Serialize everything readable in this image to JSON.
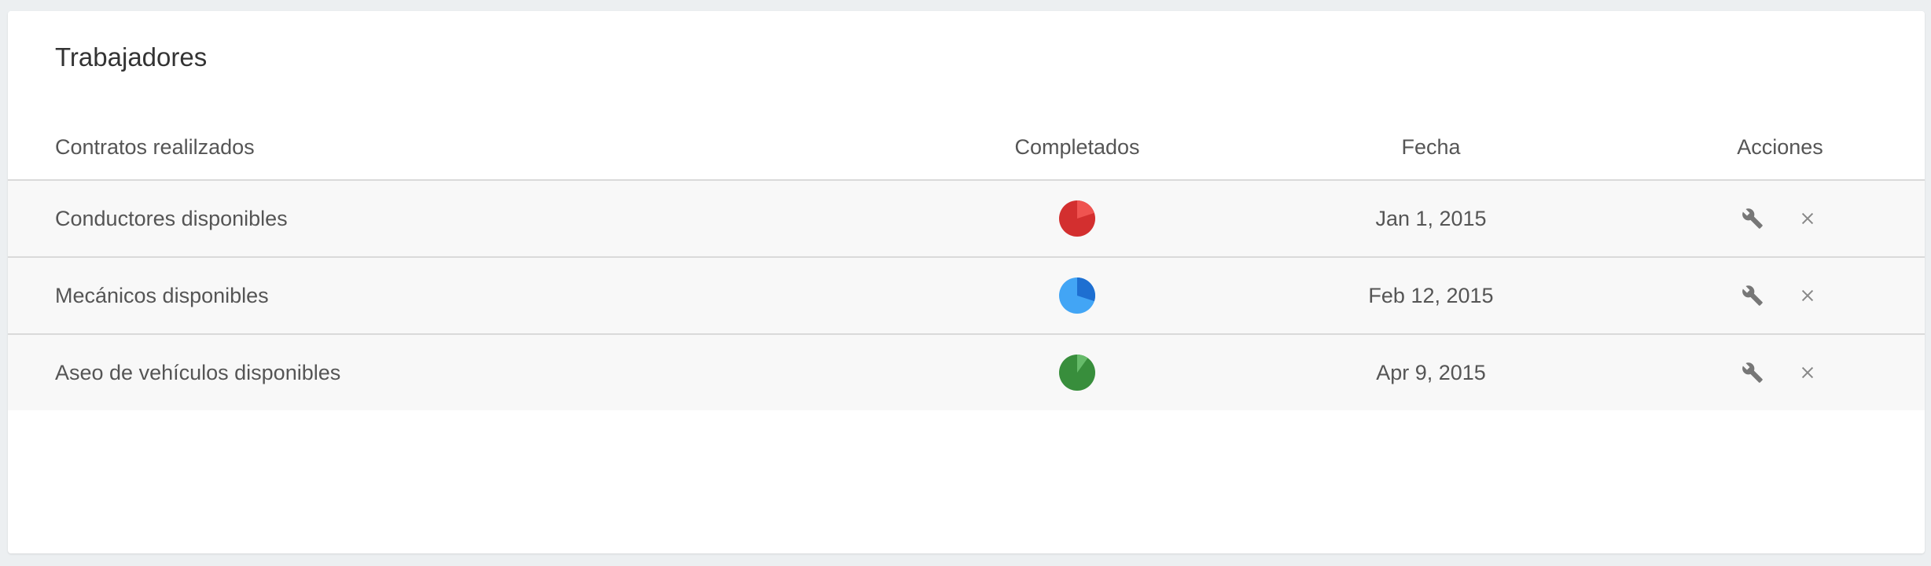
{
  "card": {
    "title": "Trabajadores"
  },
  "table": {
    "headers": [
      "Contratos realilzados",
      "Completados",
      "Fecha",
      "Acciones"
    ],
    "rows": [
      {
        "name": "Conductores disponibles",
        "completed_fraction": 0.2,
        "pie_color": "#d32f2f",
        "pie_accent": "#ef5350",
        "date": "Jan 1, 2015"
      },
      {
        "name": "Mecánicos disponibles",
        "completed_fraction": 0.3,
        "pie_color": "#42a5f5",
        "pie_accent": "#1e6fd1",
        "date": "Feb 12, 2015"
      },
      {
        "name": "Aseo de vehículos disponibles",
        "completed_fraction": 0.1,
        "pie_color": "#388e3c",
        "pie_accent": "#66bb6a",
        "date": "Apr 9, 2015"
      }
    ],
    "action_icons": [
      "wrench-icon",
      "close-icon"
    ]
  },
  "colors": {
    "background": "#eceff1",
    "card": "#ffffff",
    "row": "#f8f8f8",
    "divider": "#dadada"
  }
}
